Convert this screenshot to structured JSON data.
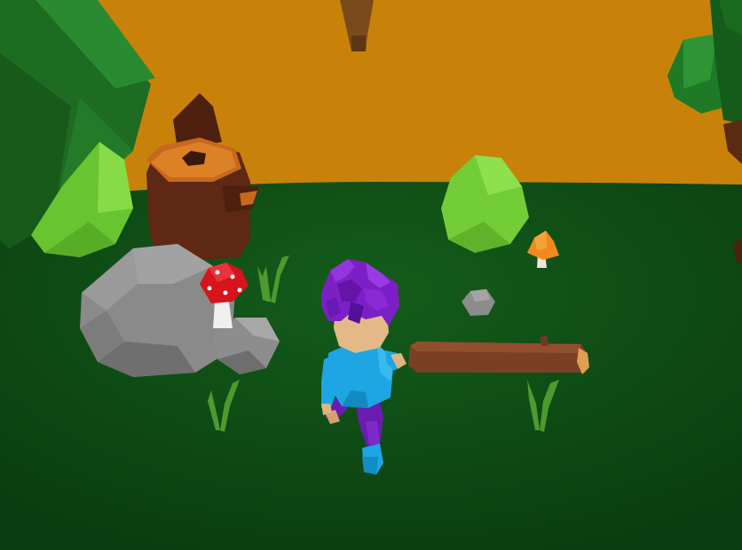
{
  "scene": {
    "colors": {
      "sky": "#c8820a",
      "ground": "#0f4f16",
      "ground_dark": "#0a3c10",
      "tree_dark": "#1f6b22",
      "bush_light": "#7ed13c",
      "rock": "#8d8d8d",
      "stump": "#6a2c16",
      "log": "#7a4024",
      "mushroom_red": "#d7131b",
      "mushroom_orange": "#f08a1a",
      "hair": "#7d1fc6",
      "shirt": "#1da6e3",
      "pants": "#6a1cb0"
    },
    "objects": [
      "tree-foliage-left",
      "bush-left",
      "stump",
      "rock-large",
      "rock-small",
      "mushroom-red",
      "bush-center",
      "mushroom-orange",
      "pebble",
      "log",
      "grass-tufts",
      "tree-right",
      "hanging-trunk",
      "player-character"
    ]
  }
}
